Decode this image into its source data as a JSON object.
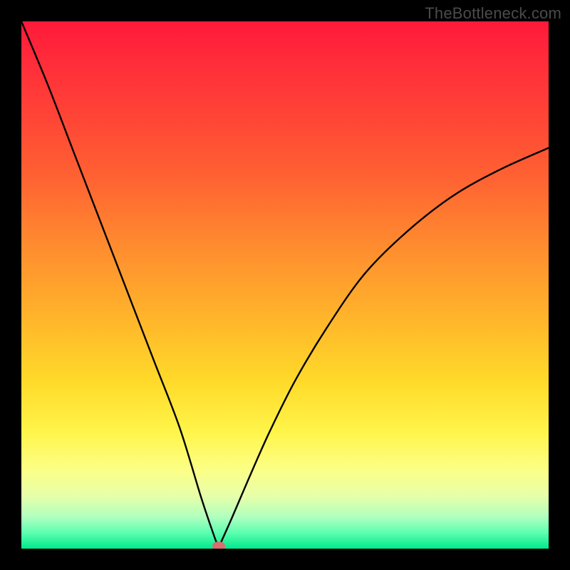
{
  "watermark": "TheBottleneck.com",
  "chart_data": {
    "type": "line",
    "title": "",
    "xlabel": "",
    "ylabel": "",
    "xlim": [
      0,
      100
    ],
    "ylim": [
      0,
      100
    ],
    "grid": false,
    "legend": false,
    "series": [
      {
        "name": "bottleneck-curve",
        "x": [
          0,
          5,
          10,
          15,
          20,
          25,
          30,
          34,
          36,
          37,
          37.5,
          38,
          40,
          43,
          47,
          52,
          58,
          65,
          73,
          82,
          91,
          100
        ],
        "y": [
          100,
          88,
          75,
          62,
          49,
          36,
          23,
          10,
          4,
          1.2,
          0.4,
          1.5,
          6,
          13,
          22,
          32,
          42,
          52,
          60,
          67,
          72,
          76
        ]
      }
    ],
    "marker": {
      "x": 37.4,
      "y": 0.4
    },
    "gradient_stops": [
      {
        "pos": 0,
        "color": "#ff193a"
      },
      {
        "pos": 50,
        "color": "#ffb12b"
      },
      {
        "pos": 80,
        "color": "#fcff86"
      },
      {
        "pos": 100,
        "color": "#00e98c"
      }
    ]
  }
}
